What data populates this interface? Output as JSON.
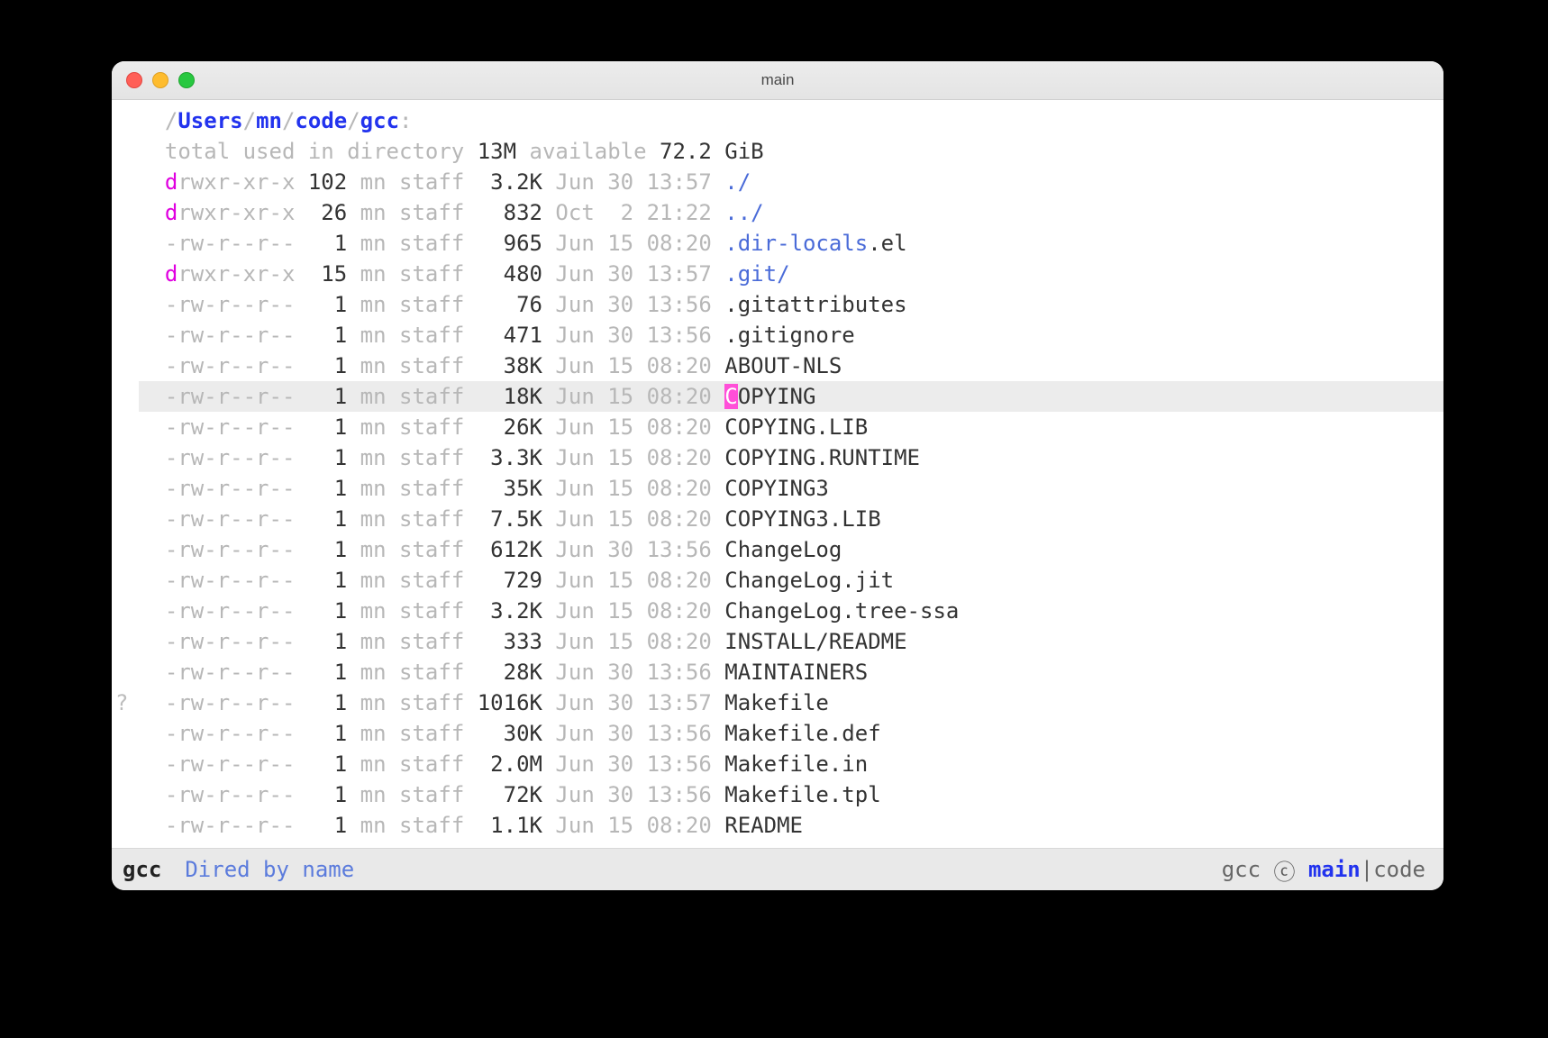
{
  "window": {
    "title": "main"
  },
  "gutter_mark": "?",
  "path": {
    "prefix": "/",
    "segments": [
      "Users",
      "mn",
      "code",
      "gcc"
    ],
    "suffix": ":"
  },
  "summary": {
    "t1": "total used in directory ",
    "used": "13M",
    "t2": " available ",
    "avail": "72.2 GiB"
  },
  "entries": [
    {
      "d": "d",
      "perm": "rwxr-xr-x",
      "links": "102",
      "own": "mn",
      "grp": "staff",
      "size": "3.2K",
      "date": "Jun 30 13:57",
      "name": "./",
      "style": "blue2",
      "sel": false
    },
    {
      "d": "d",
      "perm": "rwxr-xr-x",
      "links": "26",
      "own": "mn",
      "grp": "staff",
      "size": "832",
      "date": "Oct  2 21:22",
      "name": "../",
      "style": "blue2",
      "sel": false
    },
    {
      "d": "-",
      "perm": "rw-r--r--",
      "links": "1",
      "own": "mn",
      "grp": "staff",
      "size": "965",
      "date": "Jun 15 08:20",
      "name": ".dir-locals",
      "ext": ".el",
      "style": "blue2",
      "sel": false
    },
    {
      "d": "d",
      "perm": "rwxr-xr-x",
      "links": "15",
      "own": "mn",
      "grp": "staff",
      "size": "480",
      "date": "Jun 30 13:57",
      "name": ".git",
      "ext": "/",
      "style": "blue2",
      "sel": false
    },
    {
      "d": "-",
      "perm": "rw-r--r--",
      "links": "1",
      "own": "mn",
      "grp": "staff",
      "size": "76",
      "date": "Jun 30 13:56",
      "name": ".gitattributes",
      "style": "plain",
      "sel": false
    },
    {
      "d": "-",
      "perm": "rw-r--r--",
      "links": "1",
      "own": "mn",
      "grp": "staff",
      "size": "471",
      "date": "Jun 30 13:56",
      "name": ".gitignore",
      "style": "plain",
      "sel": false
    },
    {
      "d": "-",
      "perm": "rw-r--r--",
      "links": "1",
      "own": "mn",
      "grp": "staff",
      "size": "38K",
      "date": "Jun 15 08:20",
      "name": "ABOUT-NLS",
      "style": "plain",
      "sel": false
    },
    {
      "d": "-",
      "perm": "rw-r--r--",
      "links": "1",
      "own": "mn",
      "grp": "staff",
      "size": "18K",
      "date": "Jun 15 08:20",
      "name": "COPYING",
      "style": "plain",
      "sel": true,
      "cursor": true
    },
    {
      "d": "-",
      "perm": "rw-r--r--",
      "links": "1",
      "own": "mn",
      "grp": "staff",
      "size": "26K",
      "date": "Jun 15 08:20",
      "name": "COPYING.LIB",
      "style": "plain",
      "sel": false
    },
    {
      "d": "-",
      "perm": "rw-r--r--",
      "links": "1",
      "own": "mn",
      "grp": "staff",
      "size": "3.3K",
      "date": "Jun 15 08:20",
      "name": "COPYING.RUNTIME",
      "style": "plain",
      "sel": false
    },
    {
      "d": "-",
      "perm": "rw-r--r--",
      "links": "1",
      "own": "mn",
      "grp": "staff",
      "size": "35K",
      "date": "Jun 15 08:20",
      "name": "COPYING3",
      "style": "plain",
      "sel": false
    },
    {
      "d": "-",
      "perm": "rw-r--r--",
      "links": "1",
      "own": "mn",
      "grp": "staff",
      "size": "7.5K",
      "date": "Jun 15 08:20",
      "name": "COPYING3.LIB",
      "style": "plain",
      "sel": false
    },
    {
      "d": "-",
      "perm": "rw-r--r--",
      "links": "1",
      "own": "mn",
      "grp": "staff",
      "size": "612K",
      "date": "Jun 30 13:56",
      "name": "ChangeLog",
      "style": "plain",
      "sel": false
    },
    {
      "d": "-",
      "perm": "rw-r--r--",
      "links": "1",
      "own": "mn",
      "grp": "staff",
      "size": "729",
      "date": "Jun 15 08:20",
      "name": "ChangeLog.jit",
      "style": "plain",
      "sel": false
    },
    {
      "d": "-",
      "perm": "rw-r--r--",
      "links": "1",
      "own": "mn",
      "grp": "staff",
      "size": "3.2K",
      "date": "Jun 15 08:20",
      "name": "ChangeLog.tree-ssa",
      "style": "plain",
      "sel": false
    },
    {
      "d": "-",
      "perm": "rw-r--r--",
      "links": "1",
      "own": "mn",
      "grp": "staff",
      "size": "333",
      "date": "Jun 15 08:20",
      "name": "INSTALL/README",
      "style": "plain",
      "sel": false
    },
    {
      "d": "-",
      "perm": "rw-r--r--",
      "links": "1",
      "own": "mn",
      "grp": "staff",
      "size": "28K",
      "date": "Jun 30 13:56",
      "name": "MAINTAINERS",
      "style": "plain",
      "sel": false
    },
    {
      "d": "-",
      "perm": "rw-r--r--",
      "links": "1",
      "own": "mn",
      "grp": "staff",
      "size": "1016K",
      "date": "Jun 30 13:57",
      "name": "Makefile",
      "style": "plain",
      "sel": false,
      "mark": "?"
    },
    {
      "d": "-",
      "perm": "rw-r--r--",
      "links": "1",
      "own": "mn",
      "grp": "staff",
      "size": "30K",
      "date": "Jun 30 13:56",
      "name": "Makefile.def",
      "style": "plain",
      "sel": false
    },
    {
      "d": "-",
      "perm": "rw-r--r--",
      "links": "1",
      "own": "mn",
      "grp": "staff",
      "size": "2.0M",
      "date": "Jun 30 13:56",
      "name": "Makefile.in",
      "style": "plain",
      "sel": false
    },
    {
      "d": "-",
      "perm": "rw-r--r--",
      "links": "1",
      "own": "mn",
      "grp": "staff",
      "size": "72K",
      "date": "Jun 30 13:56",
      "name": "Makefile.tpl",
      "style": "plain",
      "sel": false
    },
    {
      "d": "-",
      "perm": "rw-r--r--",
      "links": "1",
      "own": "mn",
      "grp": "staff",
      "size": "1.1K",
      "date": "Jun 15 08:20",
      "name": "README",
      "style": "plain",
      "sel": false
    }
  ],
  "modeline": {
    "buffer": "gcc",
    "mode": "Dired by name",
    "vc_dir": "gcc",
    "vc_sym": "ⓒ",
    "branch": "main",
    "sep": "|",
    "project": "code"
  }
}
